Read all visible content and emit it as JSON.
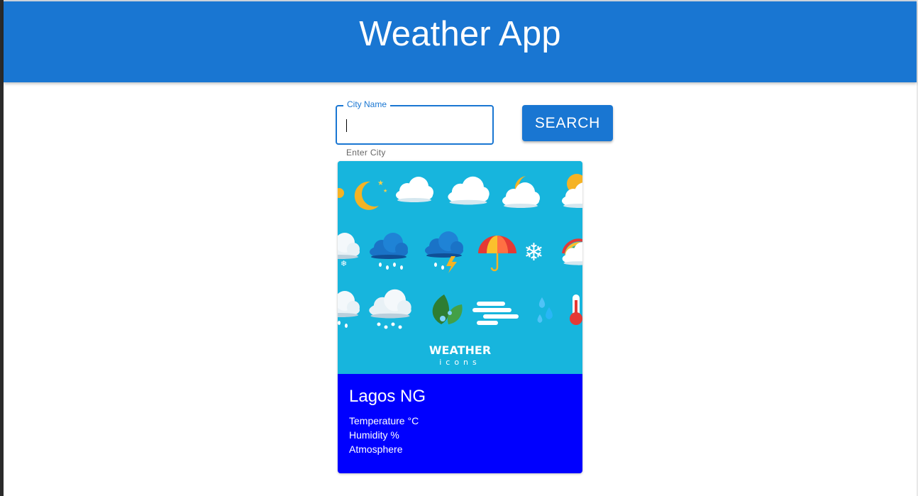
{
  "header": {
    "title": "Weather App"
  },
  "search": {
    "label": "City Name",
    "value": "",
    "helper_text": "Enter City",
    "button_label": "SEARCH"
  },
  "card": {
    "image": {
      "title": "WEATHER",
      "subtitle": "icons",
      "icons": [
        "sun-icon",
        "moon-icon",
        "cloud-icon",
        "cloud-icon",
        "moon-cloud-icon",
        "sun-cloud-icon",
        "snow-cloud-icon",
        "rain-cloud-icon",
        "storm-cloud-icon",
        "umbrella-icon",
        "snowflake-icon",
        "rainbow-icon",
        "rain-cloud-icon",
        "hail-cloud-icon",
        "leaf-icon",
        "wind-icon",
        "raindrops-icon",
        "thermometer-icon"
      ]
    },
    "city": "Lagos NG",
    "temperature_label": "Temperature °C",
    "humidity_label": "Humidity %",
    "atmosphere_label": "Atmosphere"
  },
  "colors": {
    "appbar": "#1976d2",
    "card_body": "#0000ff",
    "image_bg": "#17b5dd"
  }
}
